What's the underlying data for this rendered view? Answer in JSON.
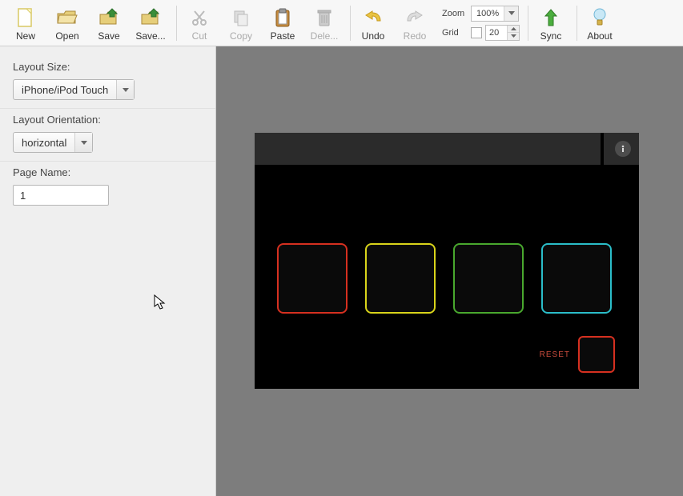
{
  "toolbar": {
    "new": "New",
    "open": "Open",
    "save": "Save",
    "saveas": "Save...",
    "cut": "Cut",
    "copy": "Copy",
    "paste": "Paste",
    "delete": "Dele...",
    "undo": "Undo",
    "redo": "Redo",
    "sync": "Sync",
    "about": "About",
    "zoom_label": "Zoom",
    "zoom_value": "100%",
    "grid_label": "Grid",
    "grid_value": "20"
  },
  "sidebar": {
    "layout_size_label": "Layout Size:",
    "layout_size_value": "iPhone/iPod Touch",
    "orientation_label": "Layout Orientation:",
    "orientation_value": "horizontal",
    "page_name_label": "Page Name:",
    "page_name_value": "1"
  },
  "canvas": {
    "reset_label": "RESET",
    "pads": [
      {
        "name": "pad-red",
        "color": "#d63020"
      },
      {
        "name": "pad-yellow",
        "color": "#d9d41a"
      },
      {
        "name": "pad-green",
        "color": "#49a82e"
      },
      {
        "name": "pad-cyan",
        "color": "#2bbec9"
      }
    ]
  }
}
